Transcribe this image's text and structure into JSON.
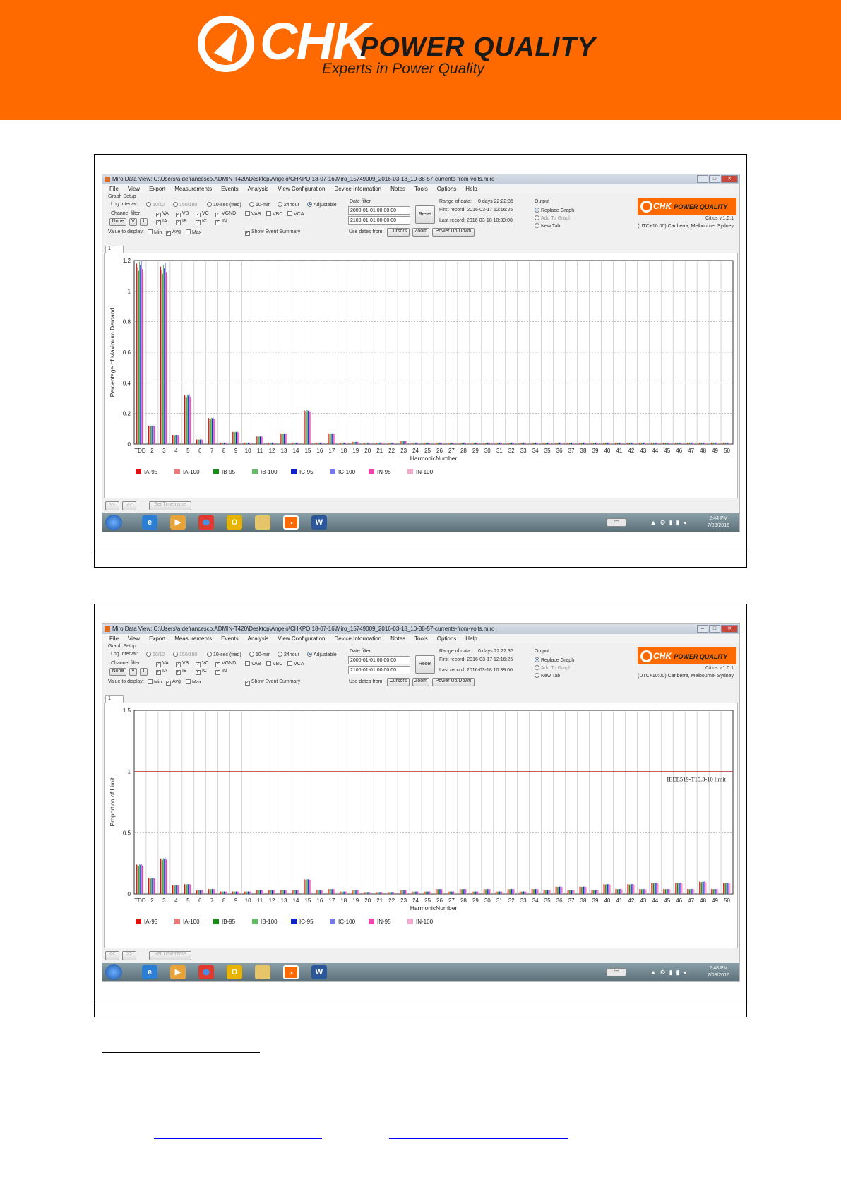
{
  "banner": {
    "logo_word": "CHK",
    "logo_sub": "POWER QUALITY",
    "tagline": "Experts in Power Quality"
  },
  "app": {
    "title": "Miro Data View: C:\\Users\\a.defrancesco.ADMIN-T420\\Desktop\\Angelo\\CHKPQ 18-07-16\\Miro_15749009_2016-03-18_10-38-57-currents-from-volts.miro",
    "window_buttons": [
      "–",
      "□",
      "✕"
    ],
    "menu": [
      "File",
      "View",
      "Export",
      "Measurements",
      "Events",
      "Analysis",
      "View Configuration",
      "Device Information",
      "Notes",
      "Tools",
      "Options",
      "Help"
    ],
    "graph_setup": "Graph Setup",
    "log_interval_label": "Log Interval:",
    "log_interval_options": [
      "10/12",
      "150/180",
      "10-sec (freq)",
      "10-min",
      "24hour",
      "Adjustable"
    ],
    "channel_filter_label": "Channel filter:",
    "channels_row1": [
      "VA",
      "VB",
      "VC",
      "VGND",
      "VAB",
      "VBC",
      "VCA"
    ],
    "channels_row2": [
      "IA",
      "IB",
      "IC",
      "IN"
    ],
    "none_btn": "None",
    "v_btn": "V",
    "i_btn": "I",
    "value_label": "Value to display:",
    "value_opts": [
      "Min",
      "Avg",
      "Max"
    ],
    "show_event": "Show Event Summary",
    "date_filter": "Date filter",
    "date1": "2000-01-01 00:00:00",
    "date2": "2100-01-01 00:00:00",
    "reset": "Reset",
    "range_label": "Range of data:",
    "range_val": "0 days 22:22:36",
    "first_record": "First record: 2016-03-17 12:16:25",
    "last_record": "Last record: 2016-03-18 10:39:00",
    "use_dates": "Use dates from:",
    "cursors": "Cursors",
    "zoom": "Zoom",
    "power": "Power Up/Down",
    "output_label": "Output",
    "output_opts": [
      "Replace Graph",
      "Add To Graph",
      "New Tab"
    ],
    "mini_logo_word": "CHK",
    "mini_logo_sub": "POWER QUALITY",
    "version": "Citius v.1.0.1",
    "timezone": "(UTC+10:00) Canberra, Melbourne, Sydney",
    "tab": "1",
    "nav_prev": "<<",
    "nav_next": ">>",
    "set_timeframe": "Set Timeframe",
    "tray_btn": "---",
    "taskbar_icons": [
      "start-orb",
      "ie",
      "media",
      "chrome",
      "outlook",
      "explorer",
      "chk",
      "word"
    ]
  },
  "screens": [
    {
      "clock_time": "2:44 PM",
      "clock_date": "7/08/2016"
    },
    {
      "clock_time": "2:48 PM",
      "clock_date": "7/08/2016"
    }
  ],
  "chart_data": [
    {
      "type": "bar",
      "xlabel": "HarmonicNumber",
      "ylabel": "Percentage of Maximum Demand",
      "ylim": [
        0,
        1.2
      ],
      "yticks": [
        "0",
        "0.2",
        "0.4",
        "0.6",
        "0.8",
        "1",
        "1.2"
      ],
      "categories": [
        "TDD",
        "2",
        "3",
        "4",
        "5",
        "6",
        "7",
        "8",
        "9",
        "10",
        "11",
        "12",
        "13",
        "14",
        "15",
        "16",
        "17",
        "18",
        "19",
        "20",
        "21",
        "22",
        "23",
        "24",
        "25",
        "26",
        "27",
        "28",
        "29",
        "30",
        "31",
        "32",
        "33",
        "34",
        "35",
        "36",
        "37",
        "38",
        "39",
        "40",
        "41",
        "42",
        "43",
        "44",
        "45",
        "46",
        "47",
        "48",
        "49",
        "50"
      ],
      "series_names": [
        "IA-95",
        "IA-100",
        "IB-95",
        "IB-100",
        "IC-95",
        "IC-100",
        "IN-95",
        "IN-100"
      ],
      "series_colors": [
        "#dd1111",
        "#ee7777",
        "#1a8a1a",
        "#66bb66",
        "#1122cc",
        "#7777ee",
        "#ee44aa",
        "#f4a8cc"
      ],
      "values": [
        1.18,
        0.12,
        1.16,
        0.06,
        0.32,
        0.03,
        0.17,
        0.01,
        0.08,
        0.01,
        0.05,
        0.01,
        0.07,
        0.01,
        0.22,
        0.01,
        0.07,
        0.01,
        0.015,
        0.01,
        0.01,
        0.01,
        0.02,
        0.01,
        0.01,
        0.01,
        0.01,
        0.01,
        0.01,
        0.01,
        0.01,
        0.01,
        0.01,
        0.01,
        0.01,
        0.01,
        0.01,
        0.01,
        0.01,
        0.01,
        0.01,
        0.01,
        0.01,
        0.01,
        0.01,
        0.01,
        0.01,
        0.01,
        0.01,
        0.01
      ]
    },
    {
      "type": "bar",
      "xlabel": "HarmonicNumber",
      "ylabel": "Proportion of Limit",
      "ylim": [
        0,
        1.5
      ],
      "yticks": [
        "0",
        "0.5",
        "1",
        "1.5"
      ],
      "limit_line": 1,
      "limit_label": "IEEE519-T10.3-10 limit",
      "categories": [
        "TDD",
        "2",
        "3",
        "4",
        "5",
        "6",
        "7",
        "8",
        "9",
        "10",
        "11",
        "12",
        "13",
        "14",
        "15",
        "16",
        "17",
        "18",
        "19",
        "20",
        "21",
        "22",
        "23",
        "24",
        "25",
        "26",
        "27",
        "28",
        "29",
        "30",
        "31",
        "32",
        "33",
        "34",
        "35",
        "36",
        "37",
        "38",
        "39",
        "40",
        "41",
        "42",
        "43",
        "44",
        "45",
        "46",
        "47",
        "48",
        "49",
        "50"
      ],
      "series_names": [
        "IA-95",
        "IA-100",
        "IB-95",
        "IB-100",
        "IC-95",
        "IC-100",
        "IN-95",
        "IN-100"
      ],
      "series_colors": [
        "#dd1111",
        "#ee7777",
        "#1a8a1a",
        "#66bb66",
        "#1122cc",
        "#7777ee",
        "#ee44aa",
        "#f4a8cc"
      ],
      "values": [
        0.24,
        0.13,
        0.29,
        0.07,
        0.08,
        0.03,
        0.04,
        0.02,
        0.02,
        0.02,
        0.03,
        0.03,
        0.03,
        0.03,
        0.12,
        0.03,
        0.04,
        0.02,
        0.03,
        0.01,
        0.01,
        0.01,
        0.03,
        0.02,
        0.02,
        0.04,
        0.02,
        0.04,
        0.02,
        0.04,
        0.02,
        0.04,
        0.02,
        0.04,
        0.03,
        0.06,
        0.03,
        0.06,
        0.03,
        0.08,
        0.04,
        0.08,
        0.04,
        0.09,
        0.04,
        0.09,
        0.04,
        0.1,
        0.04,
        0.09
      ]
    }
  ]
}
